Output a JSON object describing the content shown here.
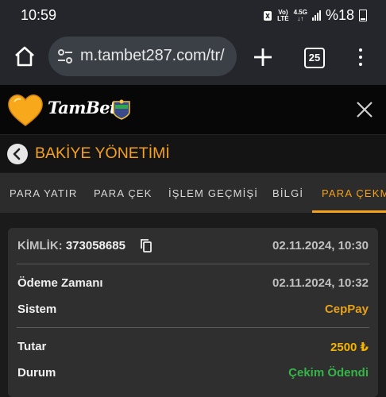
{
  "status_bar": {
    "time": "10:59",
    "net_top": "Vo)",
    "net_bottom": "LTE",
    "net2_top": "4.5G",
    "net2_bottom": "↓↑",
    "battery": "%18"
  },
  "browser": {
    "url": "m.tambet287.com/tr/",
    "tab_count": "25"
  },
  "site": {
    "logo_text": "TamBet",
    "page_title": "BAKİYE YÖNETİMİ"
  },
  "tabs": [
    {
      "label": "PARA YATIR"
    },
    {
      "label": "PARA ÇEK"
    },
    {
      "label": "İŞLEM GEÇMİŞİ"
    },
    {
      "label": "BİLGİ"
    },
    {
      "label": "PARA ÇEKM"
    }
  ],
  "transaction": {
    "id_label": "KİMLİK:",
    "id_value": "373058685",
    "created": "02.11.2024, 10:30",
    "payment_time_label": "Ödeme Zamanı",
    "payment_time": "02.11.2024, 10:32",
    "system_label": "Sistem",
    "system": "CepPay",
    "amount_label": "Tutar",
    "amount": "2500 ₺",
    "status_label": "Durum",
    "status": "Çekim Ödendi"
  },
  "colors": {
    "accent": "#f6a01c",
    "amount": "#f5b400",
    "success": "#35b548",
    "system": "#e8a21a"
  }
}
